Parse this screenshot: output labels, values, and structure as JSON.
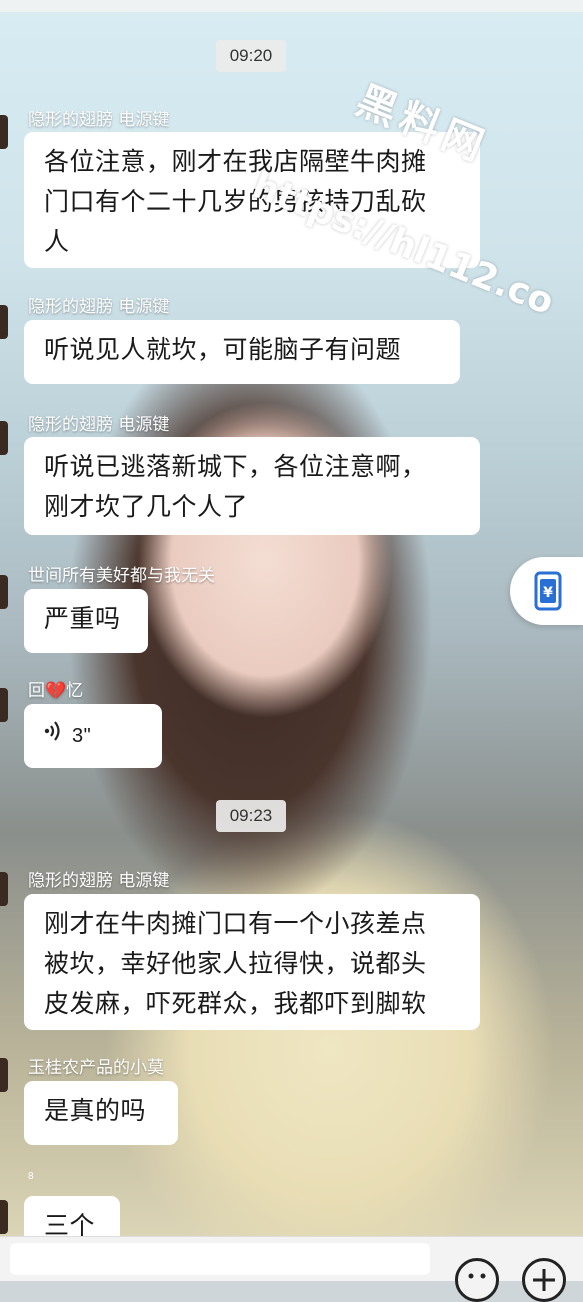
{
  "timestamps": [
    "09:20",
    "09:23"
  ],
  "watermark": {
    "text": "黑料网",
    "url": "https://hl112.co"
  },
  "messages": [
    {
      "sender": "隐形的翅膀  电源键",
      "lines": [
        "各位注意，刚才在我店隔壁牛肉摊",
        "门口有个二十几岁的男孩持刀乱砍",
        "人"
      ]
    },
    {
      "sender": "隐形的翅膀  电源键",
      "lines": [
        "听说见人就坎，可能脑子有问题"
      ]
    },
    {
      "sender": "隐形的翅膀  电源键",
      "lines": [
        "听说已逃落新城下，各位注意啊，",
        "刚才坎了几个人了"
      ]
    },
    {
      "sender": "世间所有美好都与我无关",
      "lines": [
        "严重吗"
      ]
    },
    {
      "sender": "回💔忆",
      "voice_duration": "3\""
    },
    {
      "sender": "隐形的翅膀  电源键",
      "lines": [
        "刚才在牛肉摊门口有一个小孩差点",
        "被坎，幸好他家人拉得快，说都头",
        "皮发麻，吓死群众，我都吓到脚软"
      ]
    },
    {
      "sender": "玉桂农产品的小莫",
      "lines": [
        "是真的吗"
      ]
    },
    {
      "sender": "",
      "lines": [
        "三个"
      ]
    }
  ],
  "small_marker": "8",
  "side_button_icon": "red-packet-money-icon",
  "input_icons": [
    "emoji-icon",
    "plus-icon"
  ]
}
